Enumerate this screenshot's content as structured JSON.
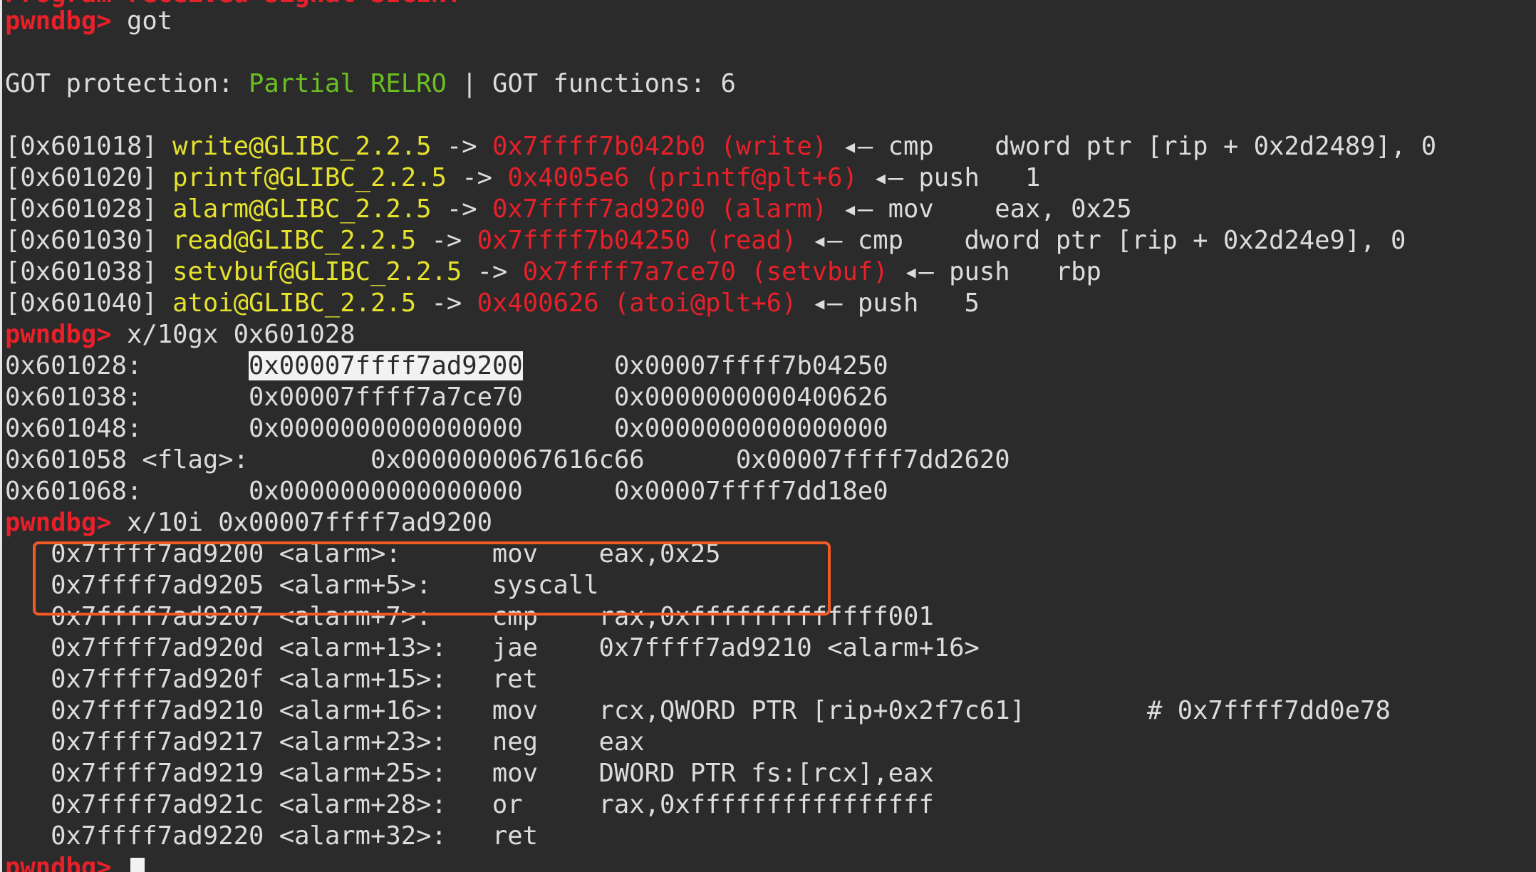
{
  "prompt": "pwndbg>",
  "top_partial": "Program received signal SIGINT",
  "cmd_got": "got",
  "got_header": {
    "prefix": "GOT protection: ",
    "relro": "Partial RELRO",
    "suffix": " | GOT functions: 6"
  },
  "got_entries": [
    {
      "slot": "[0x601018]",
      "sym": "write@GLIBC_2.2.5",
      "arrow": " -> ",
      "target": "0x7ffff7b042b0 (write)",
      "insn": " ◂— cmp    dword ptr [rip + 0x2d2489], 0"
    },
    {
      "slot": "[0x601020]",
      "sym": "printf@GLIBC_2.2.5",
      "arrow": " -> ",
      "target": "0x4005e6 (printf@plt+6)",
      "insn": " ◂— push   1"
    },
    {
      "slot": "[0x601028]",
      "sym": "alarm@GLIBC_2.2.5",
      "arrow": " -> ",
      "target": "0x7ffff7ad9200 (alarm)",
      "insn": " ◂— mov    eax, 0x25"
    },
    {
      "slot": "[0x601030]",
      "sym": "read@GLIBC_2.2.5",
      "arrow": " -> ",
      "target": "0x7ffff7b04250 (read)",
      "insn": " ◂— cmp    dword ptr [rip + 0x2d24e9], 0"
    },
    {
      "slot": "[0x601038]",
      "sym": "setvbuf@GLIBC_2.2.5",
      "arrow": " -> ",
      "target": "0x7ffff7a7ce70 (setvbuf)",
      "insn": " ◂— push   rbp"
    },
    {
      "slot": "[0x601040]",
      "sym": "atoi@GLIBC_2.2.5",
      "arrow": " -> ",
      "target": "0x400626 (atoi@plt+6)",
      "insn": " ◂— push   5"
    }
  ],
  "cmd_xgx": "x/10gx 0x601028",
  "mem_rows": [
    {
      "label": "0x601028:",
      "pad": "       ",
      "v1": "0x00007ffff7ad9200",
      "gap": "      ",
      "v2": "0x00007ffff7b04250"
    },
    {
      "label": "0x601038:",
      "pad": "       ",
      "v1": "0x00007ffff7a7ce70",
      "gap": "      ",
      "v2": "0x0000000000400626"
    },
    {
      "label": "0x601048:",
      "pad": "       ",
      "v1": "0x0000000000000000",
      "gap": "      ",
      "v2": "0x0000000000000000"
    },
    {
      "label": "0x601058 <flag>:",
      "pad": "        ",
      "v1": "0x0000000067616c66",
      "gap": "      ",
      "v2": "0x00007ffff7dd2620"
    },
    {
      "label": "0x601068:",
      "pad": "       ",
      "v1": "0x0000000000000000",
      "gap": "      ",
      "v2": "0x00007ffff7dd18e0"
    }
  ],
  "cmd_xi": "x/10i 0x00007ffff7ad9200",
  "asm_rows": [
    "   0x7ffff7ad9200 <alarm>:      mov    eax,0x25",
    "   0x7ffff7ad9205 <alarm+5>:    syscall",
    "   0x7ffff7ad9207 <alarm+7>:    cmp    rax,0xfffffffffffff001",
    "   0x7ffff7ad920d <alarm+13>:   jae    0x7ffff7ad9210 <alarm+16>",
    "   0x7ffff7ad920f <alarm+15>:   ret",
    "   0x7ffff7ad9210 <alarm+16>:   mov    rcx,QWORD PTR [rip+0x2f7c61]        # 0x7ffff7dd0e78",
    "   0x7ffff7ad9217 <alarm+23>:   neg    eax",
    "   0x7ffff7ad9219 <alarm+25>:   mov    DWORD PTR fs:[rcx],eax",
    "   0x7ffff7ad921c <alarm+28>:   or     rax,0xffffffffffffffff",
    "   0x7ffff7ad9220 <alarm+32>:   ret"
  ],
  "colors": {
    "background": "#2b2b2b",
    "text": "#dcdcdc",
    "prompt": "#e8202a",
    "symbol": "#e5e22e",
    "relro": "#6bbf23",
    "highlight_box": "#f15a24"
  }
}
